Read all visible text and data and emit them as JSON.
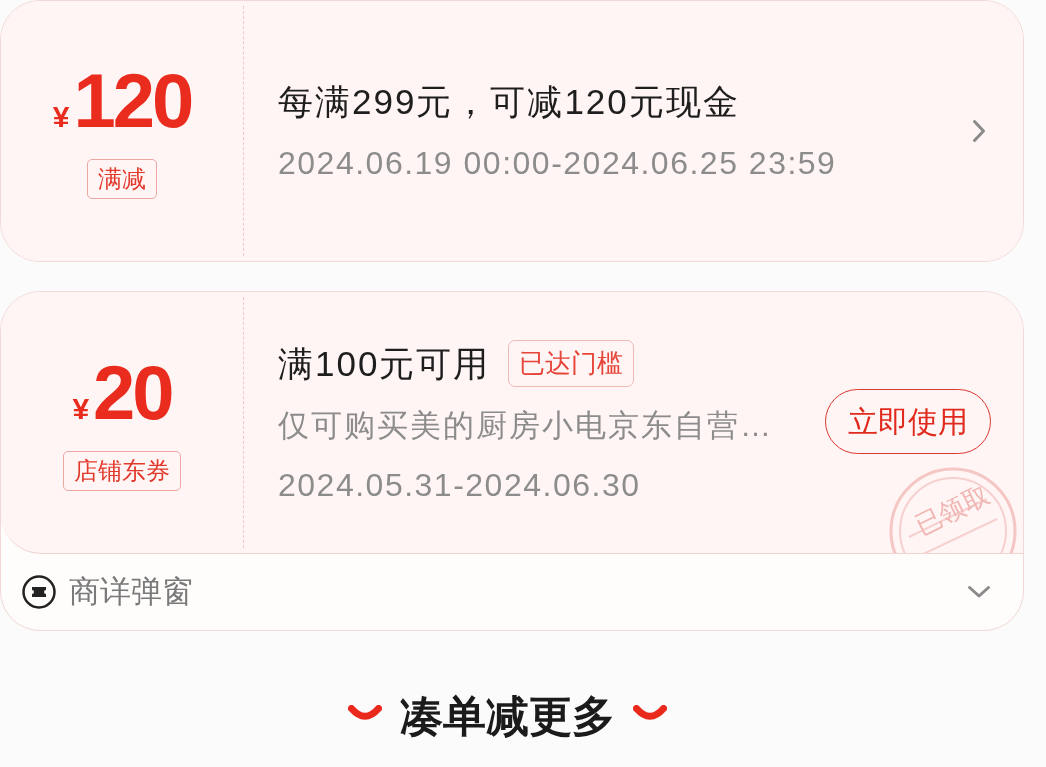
{
  "coupons": [
    {
      "kind": "link",
      "currency": "¥",
      "amount": "120",
      "type_tag": "满减",
      "title": "每满299元，可减120元现金",
      "validity": "2024.06.19 00:00-2024.06.25 23:59"
    },
    {
      "kind": "action",
      "currency": "¥",
      "amount": "20",
      "type_tag": "店铺东券",
      "title": "满100元可用",
      "threshold_badge": "已达门槛",
      "scope": "仅可购买美的厨房小电京东自营…",
      "validity": "2024.05.31-2024.06.30",
      "button": "立即使用",
      "stamp": "已领取",
      "details": {
        "label": "商详弹窗",
        "expanded": false
      }
    }
  ],
  "section_heading": "凑单减更多"
}
